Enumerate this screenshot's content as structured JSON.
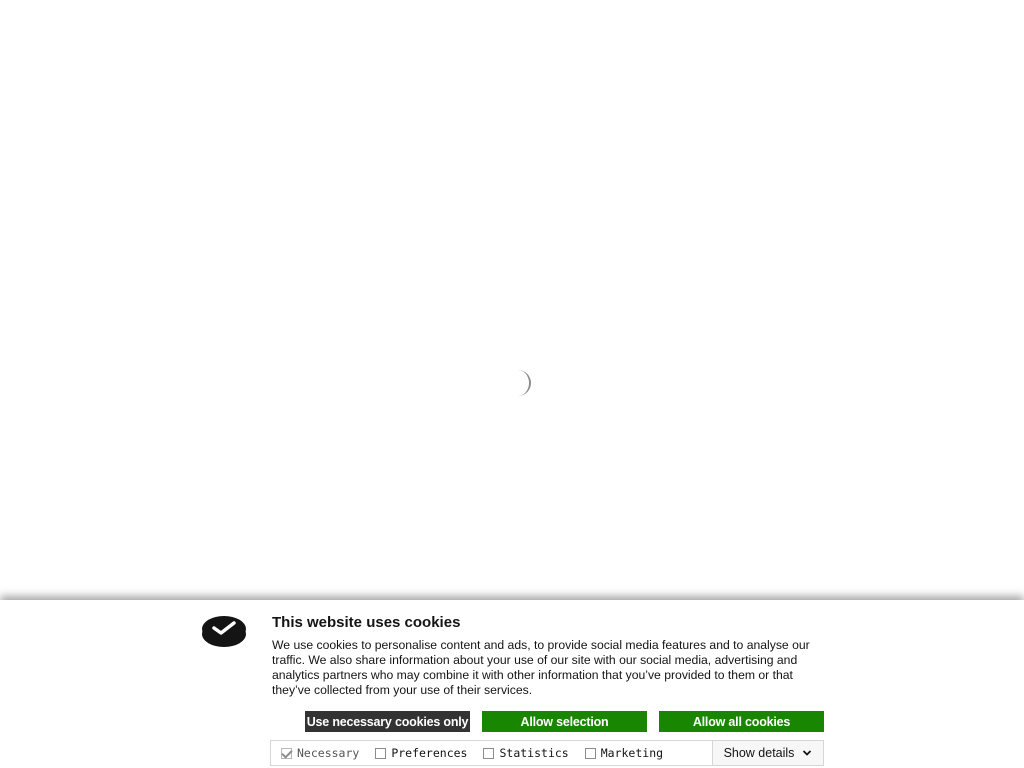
{
  "cookie_banner": {
    "title": "This website uses cookies",
    "description": "We use cookies to personalise content and ads, to provide social media features and to analyse our traffic. We also share information about your use of our site with our social media, advertising and analytics partners who may combine it with other information that you’ve provided to them or that they’ve collected from your use of their services.",
    "buttons": {
      "necessary_only": "Use necessary cookies only",
      "allow_selection": "Allow selection",
      "allow_all": "Allow all cookies"
    },
    "options": [
      {
        "label": "Necessary",
        "checked": true,
        "disabled": true
      },
      {
        "label": "Preferences",
        "checked": false,
        "disabled": false
      },
      {
        "label": "Statistics",
        "checked": false,
        "disabled": false
      },
      {
        "label": "Marketing",
        "checked": false,
        "disabled": false
      }
    ],
    "show_details": "Show details",
    "icons": {
      "logo": "cookiebot-check-logo-icon",
      "details": "chevron-down-icon",
      "loader": "loading-spinner-icon"
    },
    "colors": {
      "necessary_button": "#333333",
      "allow_button": "#188600"
    }
  }
}
